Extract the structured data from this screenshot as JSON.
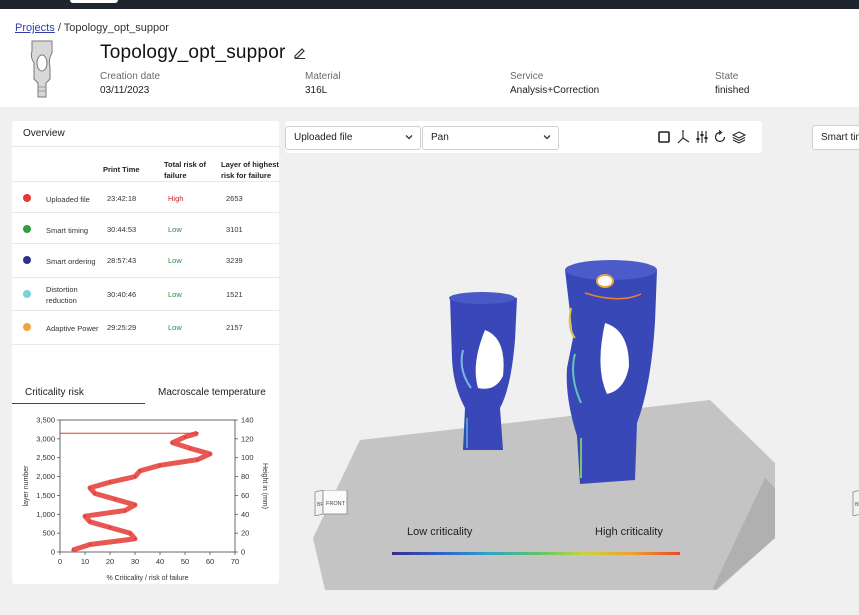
{
  "breadcrumb": {
    "root": "Projects",
    "sep": "/",
    "current": "Topology_opt_suppor"
  },
  "project": {
    "title": "Topology_opt_suppor",
    "fields": [
      {
        "label": "Creation date",
        "value": "03/11/2023"
      },
      {
        "label": "Material",
        "value": "316L"
      },
      {
        "label": "Service",
        "value": "Analysis+Correction"
      },
      {
        "label": "State",
        "value": "finished"
      }
    ]
  },
  "overview": {
    "title": "Overview",
    "headers": {
      "print_time": "Print Time",
      "risk": "Total risk of failure",
      "layer": "Layer of highest risk for failure"
    },
    "rows": [
      {
        "name": "Uploaded file",
        "time": "23:42:18",
        "risk": "High",
        "layer": "2653",
        "color": "#e53935",
        "risk_color": "#c62828"
      },
      {
        "name": "Smart timing",
        "time": "30:44:53",
        "risk": "Low",
        "layer": "3101",
        "color": "#2e9e3e",
        "risk_color": "#2e8b3a"
      },
      {
        "name": "Smart ordering",
        "time": "28:57:43",
        "risk": "Low",
        "layer": "3239",
        "color": "#2f2d8e",
        "risk_color": "#2e8b3a"
      },
      {
        "name": "Distortion reduction",
        "time": "30:40:46",
        "risk": "Low",
        "layer": "1521",
        "color": "#7ecfd6",
        "risk_color": "#2e8b3a"
      },
      {
        "name": "Adaptive Power",
        "time": "29:25:29",
        "risk": "Low",
        "layer": "2157",
        "color": "#f2a33a",
        "risk_color": "#2e8b3a"
      }
    ]
  },
  "tabs": {
    "criticality": "Criticality risk",
    "temperature": "Macroscale temperature"
  },
  "chart_data": {
    "type": "line",
    "xlabel": "% Criticality / risk of failure",
    "ylabel": "layer number",
    "y2label": "Height in (mm)",
    "xlim": [
      0,
      70
    ],
    "ylim": [
      0,
      3500
    ],
    "y2lim": [
      0,
      140
    ],
    "x_ticks": [
      "0",
      "10",
      "20",
      "30",
      "40",
      "50",
      "60",
      "70"
    ],
    "y_ticks": [
      "0",
      "500",
      "1,000",
      "1,500",
      "2,000",
      "2,500",
      "3,000",
      "3,500"
    ],
    "y2_ticks": [
      "0",
      "20",
      "40",
      "60",
      "80",
      "100",
      "120",
      "140"
    ],
    "series": [
      {
        "color": "#e53935",
        "layers": [
          50,
          200,
          350,
          500,
          650,
          800,
          950,
          1100,
          1250,
          1400,
          1550,
          1700,
          1850,
          2000,
          2150,
          2300,
          2450,
          2600,
          2750,
          2900,
          3050,
          3150
        ],
        "values": [
          5,
          12,
          30,
          28,
          20,
          12,
          10,
          26,
          30,
          22,
          14,
          12,
          20,
          30,
          32,
          40,
          55,
          60,
          52,
          45,
          50,
          55
        ]
      }
    ]
  },
  "viewer": {
    "file_select": "Uploaded file",
    "mode_select": "Pan",
    "right_select": "Smart tim",
    "legend_low": "Low criticality",
    "legend_high": "High criticality",
    "cube_left": "BF",
    "cube_front": "FRONT",
    "cube_right": "BF"
  }
}
